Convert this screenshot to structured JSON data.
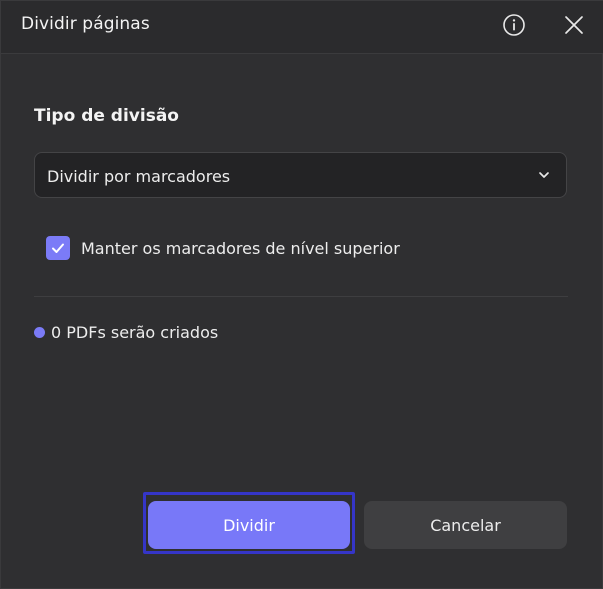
{
  "dialog": {
    "title": "Dividir páginas",
    "info_icon": "info-icon",
    "close_icon": "close-icon"
  },
  "split": {
    "section_label": "Tipo de divisão",
    "selected_option": "Dividir por marcadores",
    "checkbox_label": "Manter os marcadores de nível superior",
    "checkbox_checked": true,
    "status_text": "0 PDFs serão criados"
  },
  "buttons": {
    "primary_label": "Dividir",
    "secondary_label": "Cancelar"
  },
  "colors": {
    "accent": "#7878f8",
    "focus_ring": "#3535c8",
    "background": "#2f2f31"
  }
}
